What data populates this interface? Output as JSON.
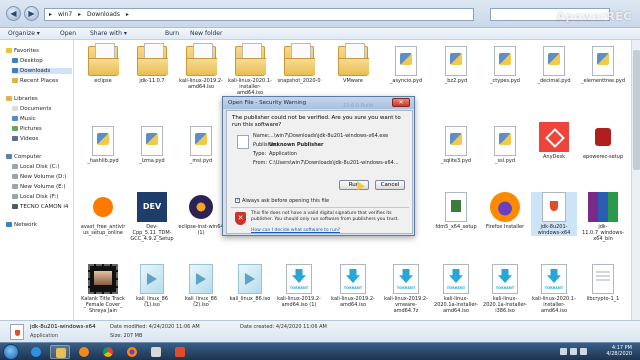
{
  "address": {
    "segments": [
      "▸",
      "win7",
      "▸",
      "Downloads",
      "▸"
    ]
  },
  "search": {
    "placeholder": ""
  },
  "watermark": "ApowerREC",
  "toolbar": {
    "organize": "Organize ▾",
    "open": "Open",
    "share": "Share with ▾",
    "burn": "Burn",
    "new_folder": "New folder"
  },
  "sidebar": {
    "favorites": "Favorites",
    "desktop": "Desktop",
    "downloads": "Downloads",
    "recent": "Recent Places",
    "libraries": "Libraries",
    "documents": "Documents",
    "music": "Music",
    "pictures": "Pictures",
    "videos": "Videos",
    "computer": "Computer",
    "disk_c": "Local Disk (C:)",
    "vol_d": "New Volume (D:)",
    "vol_e": "New Volume (E:)",
    "disk_f": "Local Disk (F:)",
    "tecno": "TECNO CAMON i4",
    "network": "Network"
  },
  "files": {
    "r1": [
      "eclipse",
      "jdk-11.0.7",
      "kali-linux-2019.2-amd64.iso",
      "kali-linux-2020.1-installer-amd64.iso",
      "snapshot_2020-0",
      "VMware",
      "_asyncio.pyd",
      "_bz2.pyd",
      "_ctypes.pyd",
      "_decimal.pyd",
      "_elementtree.pyd"
    ],
    "r2": [
      "_hashlib.pyd",
      "_lzma.pyd",
      "_msi.pyd",
      "_sqlite3.pyd",
      "_ssl.pyd",
      "AnyDesk",
      "epowerec-setup"
    ],
    "r3": [
      "avast_free_antivirus_setup_online",
      "Dev-Cpp_5.11_TDM-GCC_4.9.2_Setup",
      "eclipse-inst-win64 (1)",
      "fdm5_x64_setup",
      "Firefox Installer",
      "jdk-8u201-windows-x64",
      "jdk-11.0.7_windows-x64_bin"
    ],
    "r4": [
      "Kalank Title Track _Female Cover_ Shreya Jain",
      "kali_linux_86 (1).iso",
      "kali_linux_86 (2).iso",
      "kali_linux_86.iso",
      "kali-linux-2019.2-amd64.iso (1)",
      "kali-linux-2019.2-amd64.iso",
      "kali-linux-2019.2-vmware-amd64.7z",
      "kali-linux-2020.1a-installer-amd64.iso",
      "kali-linux-2020.1a-installer-i386.iso",
      "kali-linux-2020.1-installer-amd64.iso",
      "libcrypto-1_1"
    ]
  },
  "dialog": {
    "title": "Open File - Security Warning",
    "ghost": "23.6.0 Build",
    "message": "The publisher could not be verified.  Are you sure you want to run this software?",
    "name_k": "Name:",
    "name_v": "...\\win7\\Downloads\\jdk-8u201-windows-x64.exe",
    "publisher_k": "Publisher:",
    "publisher_v": "Unknown Publisher",
    "type_k": "Type:",
    "type_v": "Application",
    "from_k": "From:",
    "from_v": "C:\\Users\\win7\\Downloads\\jdk-8u201-windows-x64...",
    "run": "Run",
    "cancel": "Cancel",
    "always_ask": "Always ask before opening this file",
    "warning": "This file does not have a valid digital signature that verifies its publisher. You should only run software from publishers you trust.",
    "link": "How can I decide what software to run?"
  },
  "details": {
    "name": "jdk-8u201-windows-x64",
    "type": "Application",
    "modified_k": "Date modified:",
    "modified_v": "4/24/2020 11:06 AM",
    "size_k": "Size:",
    "size_v": "207 MB",
    "created_k": "Date created:",
    "created_v": "4/24/2020 11:06 AM"
  },
  "tray": {
    "time": "4:17 PM",
    "date": "4/28/2020"
  }
}
